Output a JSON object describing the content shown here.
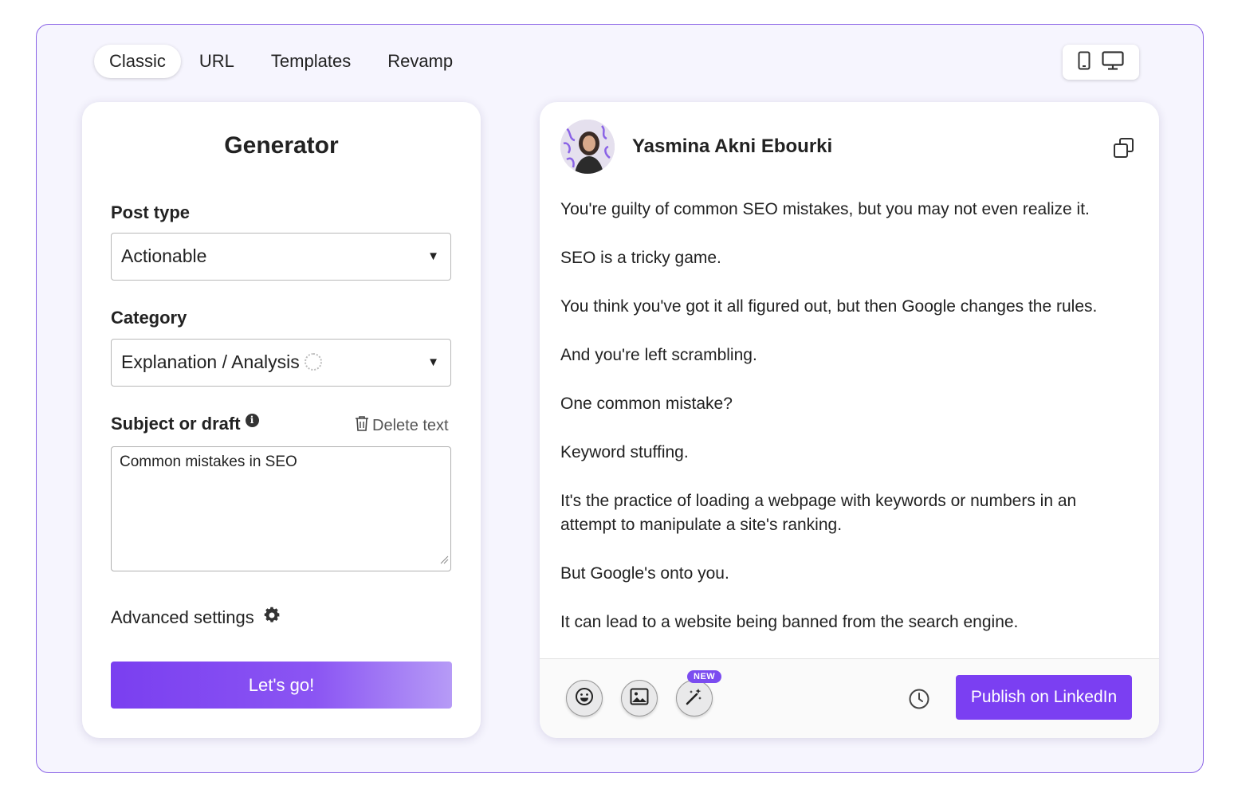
{
  "tabs": [
    {
      "label": "Classic",
      "active": true
    },
    {
      "label": "URL",
      "active": false
    },
    {
      "label": "Templates",
      "active": false
    },
    {
      "label": "Revamp",
      "active": false
    }
  ],
  "device_toggle": {
    "icons": [
      "mobile-icon",
      "desktop-icon"
    ]
  },
  "generator": {
    "title": "Generator",
    "post_type_label": "Post type",
    "post_type_value": "Actionable",
    "category_label": "Category",
    "category_value": "Explanation / Analysis",
    "subject_label": "Subject or draft",
    "delete_label": "Delete text",
    "subject_value": "Common mistakes in SEO",
    "advanced_label": "Advanced settings",
    "submit_label": "Let's go!"
  },
  "post": {
    "author": "Yasmina Akni Ebourki",
    "paragraphs": [
      "You're guilty of common SEO mistakes, but you may not even realize it.",
      "SEO is a tricky game.",
      "You think you've got it all figured out, but then Google changes the rules.",
      "And you're left scrambling.",
      "One common mistake?",
      "Keyword stuffing.",
      "It's the practice of loading a webpage with keywords or numbers in an attempt to manipulate a site's ranking.",
      "But Google's onto you.",
      "It can lead to a website being banned from the search engine."
    ],
    "new_badge": "NEW",
    "publish_label": "Publish on LinkedIn"
  },
  "colors": {
    "accent": "#7b3ff2",
    "frame_border": "#8a63e6",
    "frame_bg": "#f6f5fe"
  }
}
